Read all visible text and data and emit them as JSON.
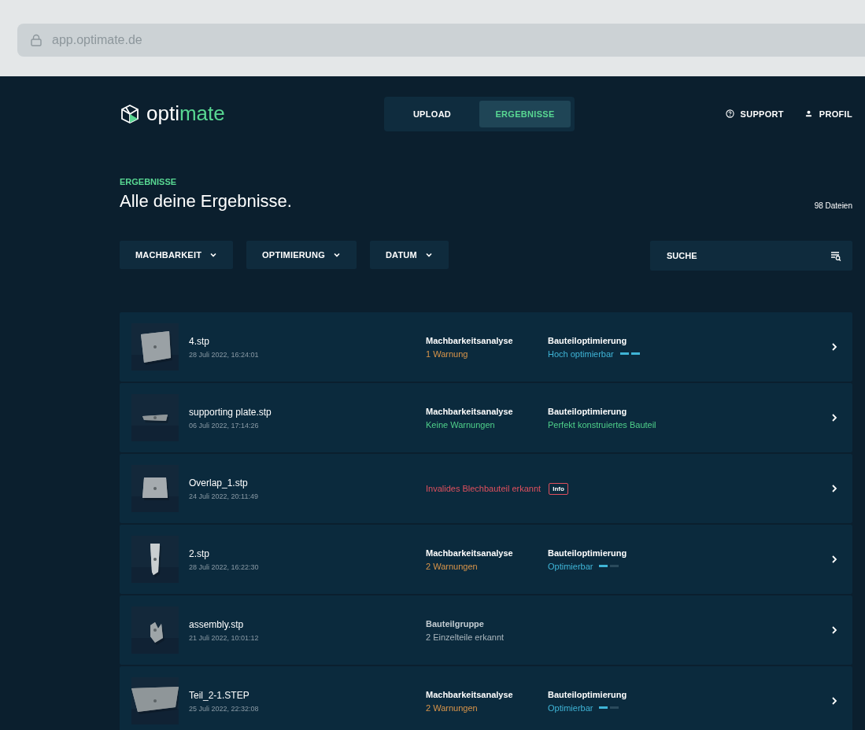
{
  "browser": {
    "url": "app.optimate.de"
  },
  "header": {
    "logo": {
      "prefix": "opti",
      "suffix": "mate"
    },
    "tabs": [
      {
        "label": "UPLOAD",
        "selected": false
      },
      {
        "label": "ERGEBNISSE",
        "selected": true
      }
    ],
    "links": [
      {
        "kind": "support",
        "label": "SUPPORT"
      },
      {
        "kind": "profile",
        "label": "PROFIL"
      }
    ]
  },
  "page": {
    "eyebrow": "ERGEBNISSE",
    "title": "Alle deine Ergebnisse.",
    "count": "98 Dateien"
  },
  "filters": [
    {
      "label": "MACHBARKEIT"
    },
    {
      "label": "OPTIMIERUNG"
    },
    {
      "label": "DATUM"
    }
  ],
  "search": {
    "placeholder": "SUCHE"
  },
  "rows": [
    {
      "kind": "analysis",
      "name": "4.stp",
      "date": "28 Juli 2022, 16:24:01",
      "analysis": {
        "label": "Machbarkeitsanalyse",
        "status": "1 Warnung",
        "color": "#d9954a"
      },
      "optimization": {
        "label": "Bauteiloptimierung",
        "status": "Hoch optimierbar",
        "color": "#3fb4d6",
        "level": 1
      }
    },
    {
      "kind": "analysis",
      "name": "supporting plate.stp",
      "date": "06 Juli 2022, 17:14:26",
      "analysis": {
        "label": "Machbarkeitsanalyse",
        "status": "Keine Warnungen",
        "color": "#4fcf8a"
      },
      "optimization": {
        "label": "Bauteiloptimierung",
        "status": "Perfekt konstruiertes Bauteil",
        "color": "#4fcf8a"
      }
    },
    {
      "kind": "error",
      "name": "Overlap_1.stp",
      "date": "24 Juli 2022, 20:11:49",
      "message": "Invalides Blechbauteil erkannt",
      "badge": "Info"
    },
    {
      "kind": "analysis",
      "name": "2.stp",
      "date": "28 Juli 2022, 16:22:30",
      "analysis": {
        "label": "Machbarkeitsanalyse",
        "status": "2 Warnungen",
        "color": "#d9954a"
      },
      "optimization": {
        "label": "Bauteiloptimierung",
        "status": "Optimierbar",
        "color": "#3fb4d6",
        "level": 0.5
      }
    },
    {
      "kind": "group",
      "name": "assembly.stp",
      "date": "21 Juli 2022, 10:01:12",
      "group": {
        "label": "Bauteilgruppe",
        "status": "2 Einzelteile erkannt"
      }
    },
    {
      "kind": "analysis",
      "name": "Teil_2-1.STEP",
      "date": "25 Juli 2022, 22:32:08",
      "analysis": {
        "label": "Machbarkeitsanalyse",
        "status": "2 Warnungen",
        "color": "#d9954a"
      },
      "optimization": {
        "label": "Bauteiloptimierung",
        "status": "Optimierbar",
        "color": "#3fb4d6",
        "level": 0.5
      }
    }
  ]
}
